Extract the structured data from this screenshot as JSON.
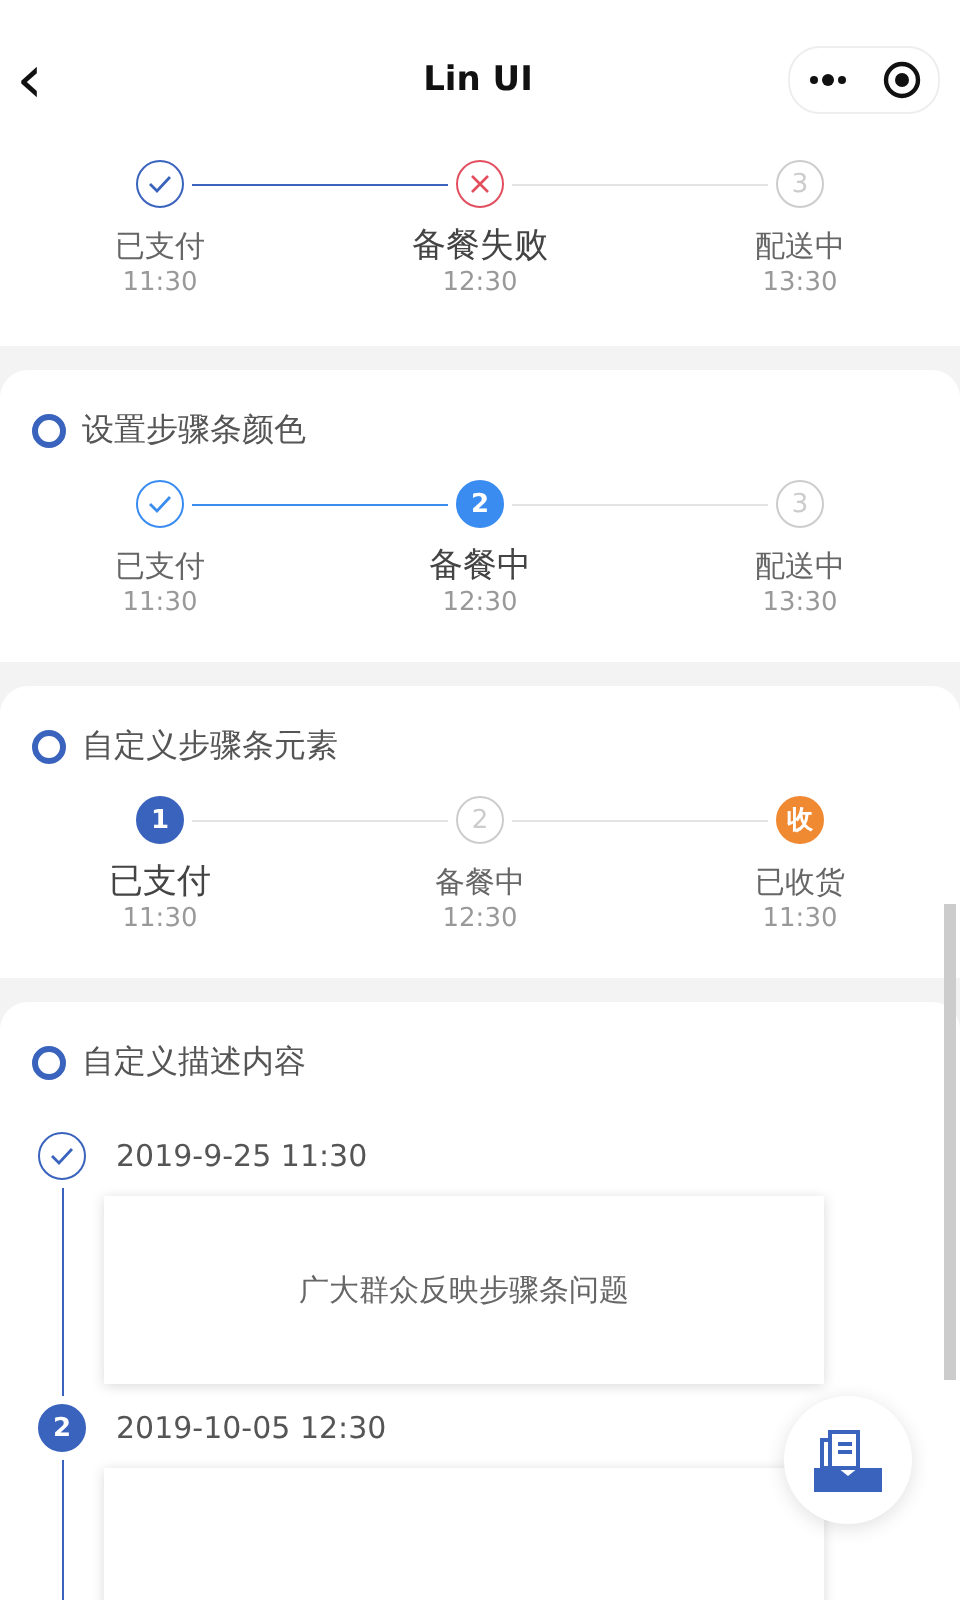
{
  "nav": {
    "title": "Lin UI",
    "back": "‹"
  },
  "sections": [
    {
      "color": "#3963bc",
      "steps": [
        {
          "kind": "done",
          "label": "已支付",
          "time": "11:30",
          "current": false
        },
        {
          "kind": "error",
          "label": "备餐失败",
          "time": "12:30",
          "current": true
        },
        {
          "kind": "pending",
          "mark": "3",
          "label": "配送中",
          "time": "13:30",
          "current": false
        }
      ]
    },
    {
      "title": "设置步骤条颜色",
      "color": "#3a8cf0",
      "steps": [
        {
          "kind": "done",
          "label": "已支付",
          "time": "11:30",
          "current": false
        },
        {
          "kind": "active",
          "mark": "2",
          "label": "备餐中",
          "time": "12:30",
          "current": true
        },
        {
          "kind": "pending",
          "mark": "3",
          "label": "配送中",
          "time": "13:30",
          "current": false
        }
      ]
    },
    {
      "title": "自定义步骤条元素",
      "color": "#3963bc",
      "steps": [
        {
          "kind": "active",
          "mark": "1",
          "label": "已支付",
          "time": "11:30",
          "current": true
        },
        {
          "kind": "pending",
          "mark": "2",
          "label": "备餐中",
          "time": "12:30",
          "current": false
        },
        {
          "kind": "custom",
          "mark": "收",
          "label": "已收货",
          "time": "11:30",
          "current": false,
          "color": "#f08a32"
        }
      ]
    }
  ],
  "timeline": {
    "title": "自定义描述内容",
    "items": [
      {
        "kind": "done",
        "date": "2019-9-25 11:30",
        "content": "广大群众反映步骤条问题"
      },
      {
        "kind": "active",
        "mark": "2",
        "date": "2019-10-05 12:30"
      }
    ]
  }
}
